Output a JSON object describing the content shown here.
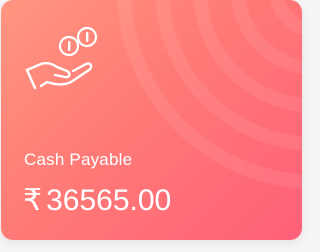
{
  "card": {
    "icon": "cash-hand-coins-icon",
    "label": "Cash Payable",
    "currency_symbol": "₹",
    "amount": "36565.00",
    "colors": {
      "gradient_start": "#ff9680",
      "gradient_end": "#ff6078",
      "text": "#ffffff"
    }
  }
}
